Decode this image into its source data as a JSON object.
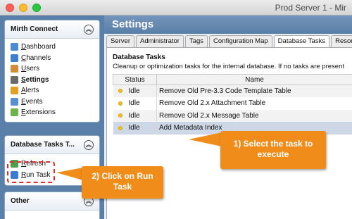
{
  "window": {
    "title": "Prod Server 1 - Mir",
    "controls": {
      "close": "close-icon",
      "minimize": "minimize-icon",
      "maximize": "maximize-icon"
    }
  },
  "sidebar": {
    "main_panel": {
      "title": "Mirth Connect",
      "collapse_icon": "double-chevron-up-icon",
      "items": [
        {
          "label": "Dashboard",
          "underline": "D",
          "rest": "ashboard",
          "icon": "dashboard-icon",
          "color": "#4a8bd6"
        },
        {
          "label": "Channels",
          "underline": "C",
          "rest": "hannels",
          "icon": "channels-icon",
          "color": "#3c7fcf"
        },
        {
          "label": "Users",
          "underline": "U",
          "rest": "sers",
          "icon": "users-icon",
          "color": "#d08c3a"
        },
        {
          "label": "Settings",
          "underline": "S",
          "rest": "ettings",
          "icon": "settings-icon",
          "color": "#6b6b6b",
          "active": true
        },
        {
          "label": "Alerts",
          "underline": "A",
          "rest": "lerts",
          "icon": "alerts-icon",
          "color": "#e0a020"
        },
        {
          "label": "Events",
          "underline": "E",
          "rest": "vents",
          "icon": "events-icon",
          "color": "#5a8fcf"
        },
        {
          "label": "Extensions",
          "underline": "E",
          "rest": "xtensions",
          "icon": "extensions-icon",
          "color": "#6fb24a"
        }
      ]
    },
    "tasks_panel": {
      "title": "Database Tasks T...",
      "collapse_icon": "double-chevron-up-icon",
      "items": [
        {
          "label": "Refresh",
          "underline": "R",
          "rest": "efresh",
          "icon": "refresh-icon",
          "color": "#4aa14a"
        },
        {
          "label": "Run Task",
          "underline": "R",
          "rest": "un Task",
          "icon": "play-icon",
          "color": "#3b7bd4"
        }
      ]
    },
    "other_panel": {
      "title": "Other",
      "collapse_icon": "double-chevron-up-icon"
    }
  },
  "main": {
    "header_title": "Settings",
    "tabs": [
      {
        "label": "Server"
      },
      {
        "label": "Administrator"
      },
      {
        "label": "Tags"
      },
      {
        "label": "Configuration Map"
      },
      {
        "label": "Database Tasks",
        "active": true
      },
      {
        "label": "Resource"
      }
    ],
    "section": {
      "title": "Database Tasks",
      "description": "Cleanup or optimization tasks for the internal database. If no tasks are present"
    },
    "table": {
      "columns": [
        "Status",
        "Name"
      ],
      "rows": [
        {
          "status": "Idle",
          "name": "Remove Old Pre-3.3 Code Template Table"
        },
        {
          "status": "Idle",
          "name": "Remove Old 2.x Attachment Table"
        },
        {
          "status": "Idle",
          "name": "Remove Old 2.x Message Table"
        },
        {
          "status": "Idle",
          "name": "Add Metadata Index",
          "selected": true
        }
      ],
      "status_dot_color": "#f0c419"
    }
  },
  "annotations": {
    "callout_select": "1) Select the task to execute",
    "callout_run": "2) Click on Run Task",
    "accent_color": "#f08c1a",
    "highlight_color": "#e02c2c"
  }
}
